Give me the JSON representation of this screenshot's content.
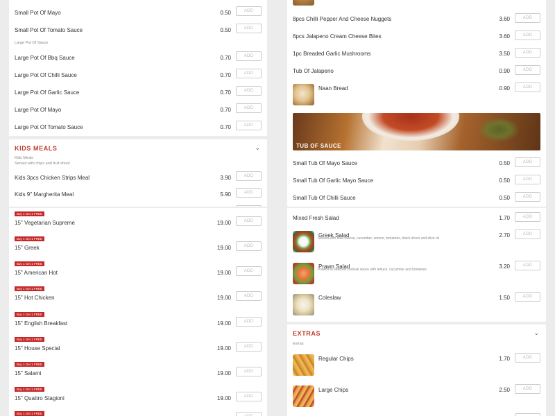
{
  "add_label": "ADD",
  "badge_label": "Buy 1 Get 1 FREE",
  "colors": {
    "accent": "#c0392b",
    "badge": "#c62828",
    "background": "#ececec"
  },
  "icons": {
    "chevron": "chevron-down-icon"
  },
  "top_left": {
    "small_items": [
      {
        "name": "Small Pot Of Mayo",
        "price": "0.50"
      },
      {
        "name": "Small Pot Of Tomato Sauce",
        "price": "0.50"
      }
    ],
    "large_label": "Large Pot Of Sauce",
    "large_items": [
      {
        "name": "Large Pot Of Bbq Sauce",
        "price": "0.70"
      },
      {
        "name": "Large Pot Of Chilli Sauce",
        "price": "0.70"
      },
      {
        "name": "Large Pot Of Garlic Sauce",
        "price": "0.70"
      },
      {
        "name": "Large Pot Of Mayo",
        "price": "0.70"
      },
      {
        "name": "Large Pot Of Tomato Sauce",
        "price": "0.70"
      }
    ],
    "kids": {
      "title": "KIDS MEALS",
      "sub_label": "Kids Meals",
      "sub_desc": "Served with chips and fruit shoot",
      "items": [
        {
          "name": "Kids 3pcs Chicken Strips Meal",
          "price": "3.90"
        },
        {
          "name": "Kids 9\" Margherita Meal",
          "price": "5.90"
        }
      ]
    }
  },
  "top_right": {
    "items": [
      {
        "name": "8pcs Chilli Pepper And Cheese Nuggets",
        "price": "3.60"
      },
      {
        "name": "6pcs Jalapeno Cream Cheese Bites",
        "price": "3.60"
      },
      {
        "name": "1pc Breaded Garlic Mushrooms",
        "price": "3.50"
      },
      {
        "name": "Tub Of Jalapeno",
        "price": "0.90"
      }
    ],
    "naan": {
      "name": "Naan Bread",
      "price": "0.90"
    },
    "banner_title": "TUB OF SAUCE",
    "sauce_items": [
      {
        "name": "Small Tub Of Mayo Sauce",
        "price": "0.50"
      },
      {
        "name": "Small Tub Of Garlic Mayo Sauce",
        "price": "0.50"
      },
      {
        "name": "Small Tub Of Chilli Sauce",
        "price": "0.50"
      }
    ]
  },
  "bottom_left": {
    "pizzas": [
      {
        "name": "15\" Vegetarian Supreme",
        "price": "19.00"
      },
      {
        "name": "15\" Greek",
        "price": "19.00"
      },
      {
        "name": "15\" American Hot",
        "price": "19.00"
      },
      {
        "name": "15\" Hot Chicken",
        "price": "19.00"
      },
      {
        "name": "15\" English Breakfast",
        "price": "19.00"
      },
      {
        "name": "15\" House Special",
        "price": "19.00"
      },
      {
        "name": "15\" Salami",
        "price": "19.00"
      },
      {
        "name": "15\" Quattro Stagioni",
        "price": "19.00"
      }
    ]
  },
  "bottom_right": {
    "mixed": {
      "name": "Mixed Fresh Salad",
      "price": "1.70"
    },
    "greek": {
      "name": "Greek Salad",
      "price": "2.70",
      "desc": "Served with feta cheese, cucumber, onions, tomatoes, black olives and olive oil"
    },
    "prawn": {
      "name": "Prawn Salad",
      "price": "3.20",
      "desc": "Prawns in seafood cocktail sauce with lettuce, cucumber and tomatoes"
    },
    "coleslaw": {
      "name": "Coleslaw",
      "price": "1.50"
    },
    "extras": {
      "title": "EXTRAS",
      "sub_label": "Extras",
      "items": [
        {
          "name": "Regular Chips",
          "price": "1.70"
        },
        {
          "name": "Large Chips",
          "price": "2.50"
        }
      ]
    }
  }
}
